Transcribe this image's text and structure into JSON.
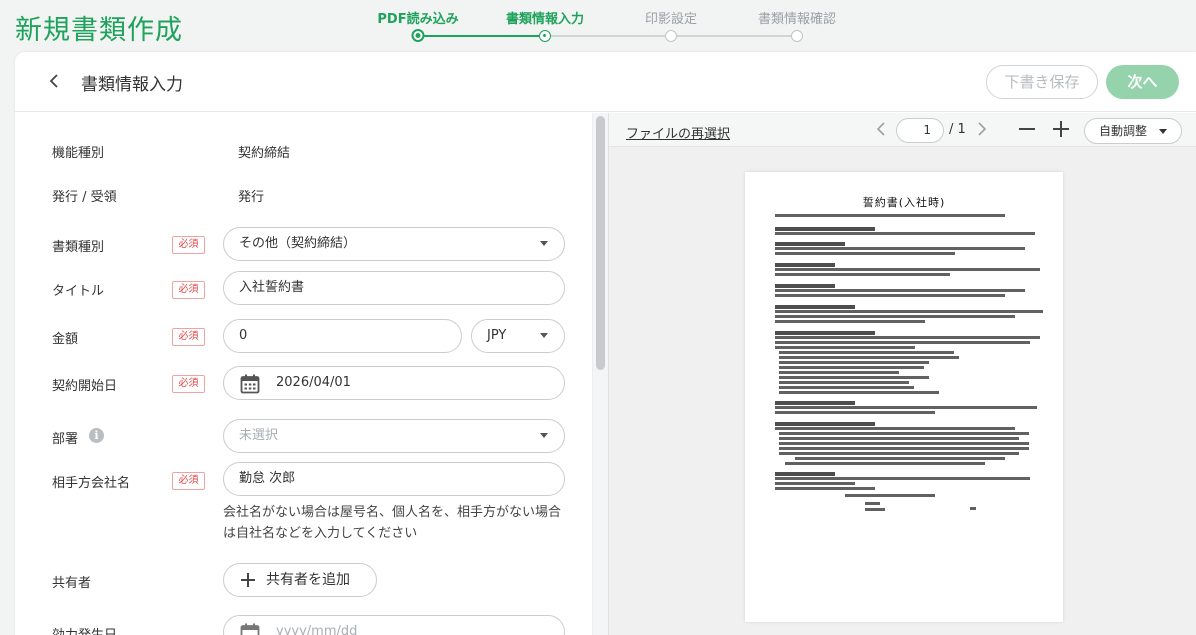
{
  "app": {
    "page_title": "新規書類作成"
  },
  "stepper": {
    "steps": [
      {
        "label": "PDF読み込み",
        "state": "done"
      },
      {
        "label": "書類情報入力",
        "state": "current"
      },
      {
        "label": "印影設定",
        "state": "todo"
      },
      {
        "label": "書類情報確認",
        "state": "todo"
      }
    ]
  },
  "header": {
    "section_title": "書類情報入力",
    "draft_label": "下書き保存",
    "next_label": "次へ"
  },
  "form": {
    "required_badge": "必須",
    "function_type": {
      "label": "機能種別",
      "value": "契約締結"
    },
    "issue_receive": {
      "label": "発行 / 受領",
      "value": "発行"
    },
    "doc_type": {
      "label": "書類種別",
      "value": "その他（契約締結）"
    },
    "title": {
      "label": "タイトル",
      "value": "入社誓約書"
    },
    "amount": {
      "label": "金額",
      "value": "0",
      "currency": "JPY"
    },
    "start_date": {
      "label": "契約開始日",
      "value": "2026/04/01"
    },
    "department": {
      "label": "部署",
      "placeholder": "未選択"
    },
    "counterparty": {
      "label": "相手方会社名",
      "value": "勤怠 次郎",
      "hint": "会社名がない場合は屋号名、個人名を、相手方がない場合は自社名などを入力してください"
    },
    "sharers": {
      "label": "共有者",
      "add_label": "共有者を追加"
    },
    "effective_date": {
      "label": "効力発生日",
      "placeholder": "yyyy/mm/dd"
    }
  },
  "preview": {
    "reselect_label": "ファイルの再選択",
    "current_page": "1",
    "total_pages": "/ 1",
    "zoom_mode": "自動調整",
    "document_title": "誓約書(入社時)"
  },
  "colors": {
    "brand_green": "#1fa35c",
    "next_button": "#95d3ad",
    "required_red": "#e04848"
  }
}
